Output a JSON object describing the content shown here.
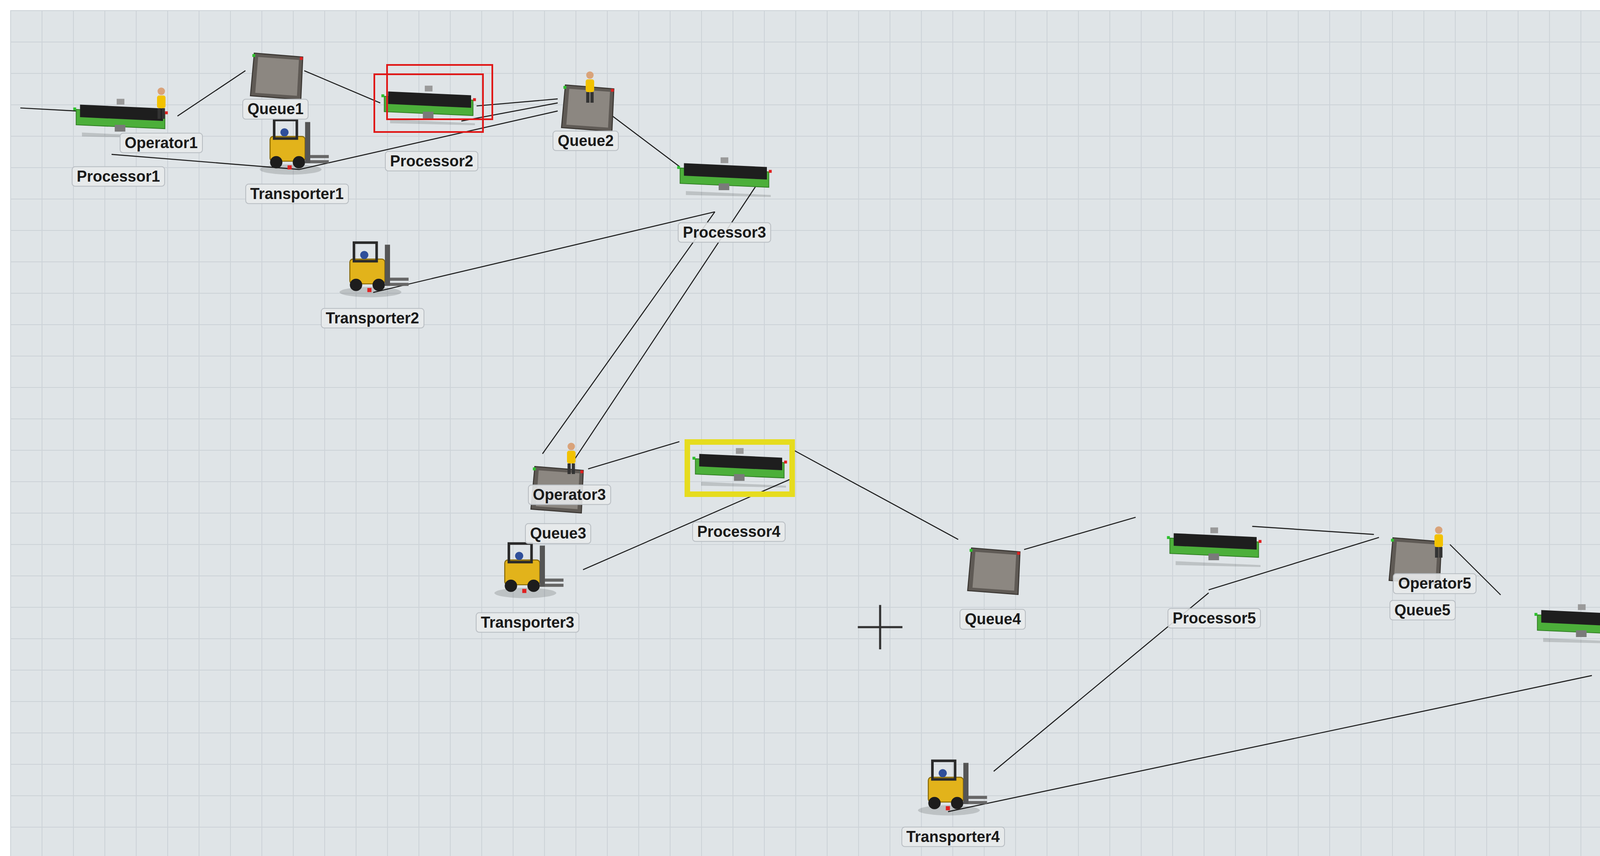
{
  "view": {
    "kind": "3d-model-view"
  },
  "objects": [
    {
      "label": "Processor1",
      "kind": "processor",
      "selected": false,
      "highlighted": false
    },
    {
      "label": "Operator1",
      "kind": "operator",
      "selected": false,
      "highlighted": false
    },
    {
      "label": "Queue1",
      "kind": "queue",
      "selected": false,
      "highlighted": false
    },
    {
      "label": "Transporter1",
      "kind": "transporter",
      "selected": false,
      "highlighted": false
    },
    {
      "label": "Processor2",
      "kind": "processor",
      "selected": true,
      "highlighted": false
    },
    {
      "label": "Queue2",
      "kind": "queue",
      "selected": false,
      "highlighted": false
    },
    {
      "kind": "operator",
      "selected": false,
      "highlighted": false
    },
    {
      "label": "Processor3",
      "kind": "processor",
      "selected": false,
      "highlighted": false
    },
    {
      "label": "Transporter2",
      "kind": "transporter",
      "selected": false,
      "highlighted": false
    },
    {
      "label": "Queue3",
      "kind": "queue",
      "selected": false,
      "highlighted": false
    },
    {
      "label": "Operator3",
      "kind": "operator",
      "selected": false,
      "highlighted": false
    },
    {
      "label": "Processor4",
      "kind": "processor",
      "selected": false,
      "highlighted": true
    },
    {
      "label": "Transporter3",
      "kind": "transporter",
      "selected": false,
      "highlighted": false
    },
    {
      "label": "Queue4",
      "kind": "queue",
      "selected": false,
      "highlighted": false
    },
    {
      "label": "Processor5",
      "kind": "processor",
      "selected": false,
      "highlighted": false
    },
    {
      "label": "Queue5",
      "kind": "queue",
      "selected": false,
      "highlighted": false
    },
    {
      "label": "Operator5",
      "kind": "operator",
      "selected": false,
      "highlighted": false
    },
    {
      "kind": "processor",
      "selected": false,
      "highlighted": false
    },
    {
      "label": "Transporter4",
      "kind": "transporter",
      "selected": false,
      "highlighted": false
    }
  ]
}
